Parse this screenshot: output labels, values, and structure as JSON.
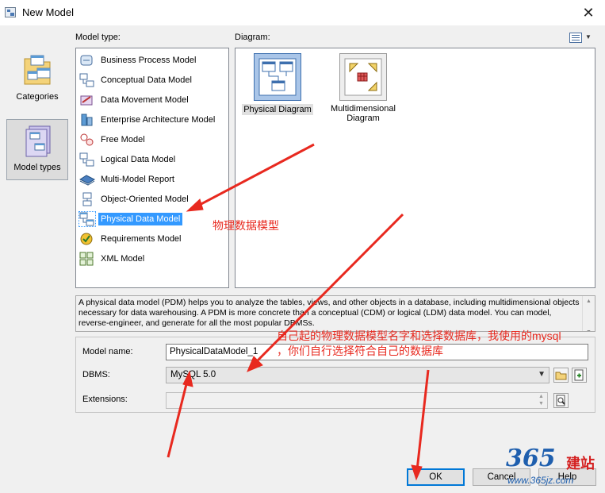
{
  "window": {
    "title": "New Model",
    "close_glyph": "✕"
  },
  "labels": {
    "model_type": "Model type:",
    "diagram": "Diagram:"
  },
  "categories": [
    {
      "label": "Categories",
      "icon": "categories-folder-icon"
    },
    {
      "label": "Model types",
      "icon": "model-types-icon"
    }
  ],
  "model_types": [
    {
      "label": "Business Process Model",
      "icon": "business-process-model-icon"
    },
    {
      "label": "Conceptual Data Model",
      "icon": "conceptual-data-model-icon"
    },
    {
      "label": "Data Movement Model",
      "icon": "data-movement-model-icon"
    },
    {
      "label": "Enterprise Architecture Model",
      "icon": "enterprise-architecture-model-icon"
    },
    {
      "label": "Free Model",
      "icon": "free-model-icon"
    },
    {
      "label": "Logical Data Model",
      "icon": "logical-data-model-icon"
    },
    {
      "label": "Multi-Model Report",
      "icon": "multi-model-report-icon"
    },
    {
      "label": "Object-Oriented Model",
      "icon": "object-oriented-model-icon"
    },
    {
      "label": "Physical Data Model",
      "icon": "physical-data-model-icon",
      "selected": true
    },
    {
      "label": "Requirements Model",
      "icon": "requirements-model-icon"
    },
    {
      "label": "XML Model",
      "icon": "xml-model-icon"
    }
  ],
  "diagrams": [
    {
      "label": "Physical Diagram",
      "icon": "physical-diagram-icon",
      "selected": true
    },
    {
      "label": "Multidimensional Diagram",
      "line1": "Multidimensional",
      "line2": "Diagram",
      "icon": "multidimensional-diagram-icon"
    }
  ],
  "description": "A physical data model (PDM) helps you to analyze the tables, views, and other objects in a database, including multidimensional objects necessary for data warehousing. A PDM is more concrete than a conceptual (CDM) or logical (LDM) data model. You can model, reverse-engineer, and generate for all the most popular DBMSs.",
  "form": {
    "model_name_label": "Model name:",
    "model_name_value": "PhysicalDataModel_1",
    "dbms_label": "DBMS:",
    "dbms_value": "MySQL 5.0",
    "extensions_label": "Extensions:",
    "extensions_value": ""
  },
  "buttons": {
    "ok": "OK",
    "cancel": "Cancel",
    "help": "Help"
  },
  "annotations": {
    "pdm_note": "物理数据模型",
    "name_note_line1": "自己起的物理数据模型名字和选择数据库，我使用的mysql",
    "name_note_line2": "，你们自行选择符合自己的数据库"
  },
  "watermark": {
    "number": "365",
    "brand": "建站",
    "url": "www.365jz.com"
  },
  "colors": {
    "selection": "#3399ff",
    "annotation": "#e8291f",
    "default_button_border": "#0078d7"
  }
}
